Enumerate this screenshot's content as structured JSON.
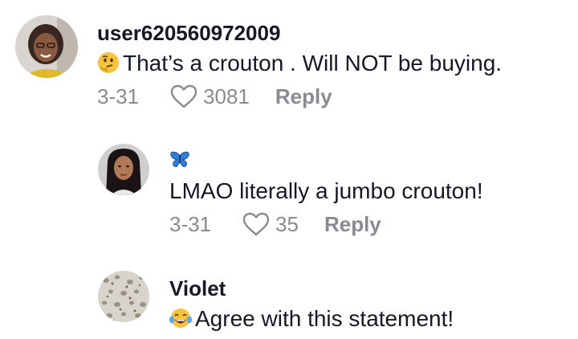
{
  "comments": [
    {
      "username": "user620560972009",
      "text": "That’s a crouton . Will NOT be buying.",
      "emoji": "thinking-face",
      "date": "3-31",
      "likes": "3081",
      "reply_label": "Reply"
    },
    {
      "username_emoji": "blue-butterfly",
      "text": "LMAO literally a jumbo crouton!",
      "date": "3-31",
      "likes": "35",
      "reply_label": "Reply"
    },
    {
      "username": "Violet",
      "text": "Agree with this statement!",
      "emoji": "tears-of-joy-face"
    }
  ],
  "colors": {
    "text_primary": "#161823",
    "text_secondary": "#8a8b91",
    "butterfly": "#2f7fe0"
  }
}
